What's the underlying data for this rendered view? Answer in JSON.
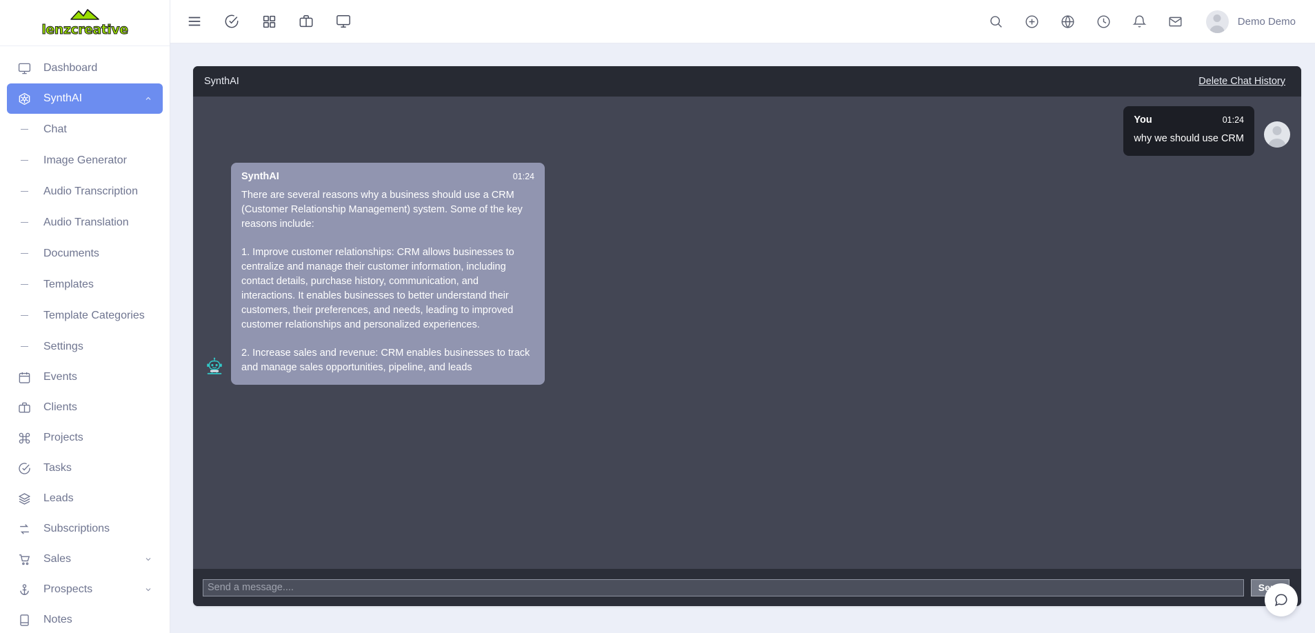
{
  "brand": {
    "name": "lenzcreative",
    "accent": "#9ade00",
    "logo_icon": "mountain-icon"
  },
  "sidebar": {
    "items": [
      {
        "label": "Dashboard",
        "icon": "monitor-icon",
        "type": "item",
        "active": false
      },
      {
        "label": "SynthAI",
        "icon": "cube-icon",
        "type": "item",
        "active": true,
        "caret": "chevron-up-icon"
      },
      {
        "label": "Chat",
        "type": "sub"
      },
      {
        "label": "Image Generator",
        "type": "sub"
      },
      {
        "label": "Audio Transcription",
        "type": "sub"
      },
      {
        "label": "Audio Translation",
        "type": "sub"
      },
      {
        "label": "Documents",
        "type": "sub"
      },
      {
        "label": "Templates",
        "type": "sub"
      },
      {
        "label": "Template Categories",
        "type": "sub"
      },
      {
        "label": "Settings",
        "type": "sub"
      },
      {
        "label": "Events",
        "icon": "calendar-icon",
        "type": "item",
        "active": false
      },
      {
        "label": "Clients",
        "icon": "briefcase-icon",
        "type": "item",
        "active": false
      },
      {
        "label": "Projects",
        "icon": "command-icon",
        "type": "item",
        "active": false
      },
      {
        "label": "Tasks",
        "icon": "check-circle-icon",
        "type": "item",
        "active": false
      },
      {
        "label": "Leads",
        "icon": "layers-icon",
        "type": "item",
        "active": false
      },
      {
        "label": "Subscriptions",
        "icon": "refresh-icon",
        "type": "item",
        "active": false
      },
      {
        "label": "Sales",
        "icon": "cart-icon",
        "type": "item",
        "active": false,
        "caret": "chevron-down-icon"
      },
      {
        "label": "Prospects",
        "icon": "anchor-icon",
        "type": "item",
        "active": false,
        "caret": "chevron-down-icon"
      },
      {
        "label": "Notes",
        "icon": "book-icon",
        "type": "item",
        "active": false
      }
    ]
  },
  "topbar": {
    "left_icons": [
      "hamburger-menu-icon",
      "check-circle-icon",
      "grid-icon",
      "briefcase-icon",
      "monitor-icon"
    ],
    "right_icons": [
      "search-icon",
      "plus-circle-icon",
      "globe-icon",
      "clock-icon",
      "bell-icon",
      "mail-icon"
    ],
    "user": {
      "name": "Demo Demo",
      "avatar": "user-avatar"
    }
  },
  "chat": {
    "title": "SynthAI",
    "delete_link": "Delete Chat History",
    "messages": [
      {
        "role": "user",
        "sender": "You",
        "time": "01:24",
        "text": "why we should use CRM"
      },
      {
        "role": "bot",
        "sender": "SynthAI",
        "time": "01:24",
        "paragraphs": [
          "There are several reasons why a business should use a CRM (Customer Relationship Management) system. Some of the key reasons include:",
          "1. Improve customer relationships: CRM allows businesses to centralize and manage their customer information, including contact details, purchase history, communication, and interactions. It enables businesses to better understand their customers, their preferences, and needs, leading to improved customer relationships and personalized experiences.",
          "2. Increase sales and revenue: CRM enables businesses to track and manage sales opportunities, pipeline, and leads"
        ]
      }
    ],
    "input_placeholder": "Send a message....",
    "input_value": "",
    "send_label": "Send",
    "widget_icon": "chat-bubble-icon"
  },
  "colors": {
    "sidebar_active": "#6c8df0",
    "chat_body": "#434654",
    "chat_header": "#272a33",
    "bot_bubble": "#9195b0",
    "user_bubble": "#1c1e25",
    "page_bg": "#eceff8"
  }
}
